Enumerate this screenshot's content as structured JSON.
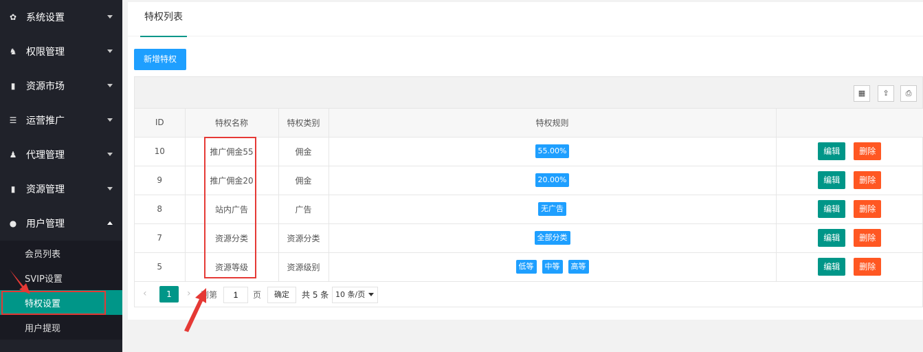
{
  "sidebar": {
    "items": [
      {
        "label": "系统设置",
        "icon": "gear-icon",
        "glyph": "✿"
      },
      {
        "label": "权限管理",
        "icon": "key-icon",
        "glyph": "♞"
      },
      {
        "label": "资源市场",
        "icon": "folder-icon",
        "glyph": "▮"
      },
      {
        "label": "运营推广",
        "icon": "list-icon",
        "glyph": "☰"
      },
      {
        "label": "代理管理",
        "icon": "user-group-icon",
        "glyph": "♟"
      },
      {
        "label": "资源管理",
        "icon": "folder-icon",
        "glyph": "▮"
      },
      {
        "label": "用户管理",
        "icon": "user-icon",
        "glyph": "●"
      }
    ],
    "subitems": [
      "会员列表",
      "SVIP设置",
      "特权设置",
      "用户提现"
    ]
  },
  "main": {
    "tab": "特权列表",
    "add_button": "新增特权",
    "toolbar": {
      "filter": "▦",
      "export": "⇪",
      "print": "⎙"
    },
    "columns": [
      "ID",
      "特权名称",
      "特权类别",
      "特权规则",
      ""
    ],
    "rows": [
      {
        "id": "10",
        "name": "推广佣金55",
        "category": "佣金",
        "rules": [
          "55.00%"
        ]
      },
      {
        "id": "9",
        "name": "推广佣金20",
        "category": "佣金",
        "rules": [
          "20.00%"
        ]
      },
      {
        "id": "8",
        "name": "站内广告",
        "category": "广告",
        "rules": [
          "无广告"
        ]
      },
      {
        "id": "7",
        "name": "资源分类",
        "category": "资源分类",
        "rules": [
          "全部分类"
        ]
      },
      {
        "id": "5",
        "name": "资源等级",
        "category": "资源级别",
        "rules": [
          "低等",
          "中等",
          "高等"
        ]
      }
    ],
    "edit_label": "编辑",
    "delete_label": "删除",
    "pager": {
      "prev": "‹",
      "current": "1",
      "next": "›",
      "goto_label": "到第",
      "goto_value": "1",
      "page_unit": "页",
      "confirm": "确定",
      "total": "共 5 条",
      "page_size": "10 条/页"
    }
  },
  "colors": {
    "sidebar_bg": "#20222a",
    "active": "#009688",
    "primary": "#1e9fff",
    "danger": "#ff5722",
    "highlight": "#e53935"
  }
}
